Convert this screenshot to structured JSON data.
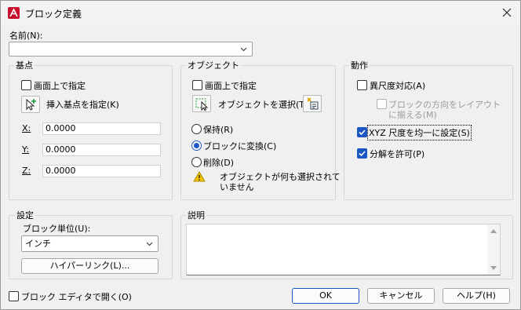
{
  "window": {
    "title": "ブロック定義"
  },
  "name_field": {
    "label": "名前(N):",
    "value": ""
  },
  "basepoint": {
    "title": "基点",
    "specify_on_screen": "画面上で指定",
    "pick_button": "挿入基点を指定(K)",
    "x_label": "X:",
    "x": "0.0000",
    "y_label": "Y:",
    "y": "0.0000",
    "z_label": "Z:",
    "z": "0.0000"
  },
  "objects": {
    "title": "オブジェクト",
    "specify_on_screen": "画面上で指定",
    "select_button": "オブジェクトを選択(T)",
    "retain": "保持(R)",
    "convert": "ブロックに変換(C)",
    "delete": "削除(D)",
    "warning": [
      "オブジェクトが何も選択されて",
      "いません"
    ]
  },
  "behavior": {
    "title": "動作",
    "annotative": "異尺度対応(A)",
    "match_orientation": [
      "ブロックの方向をレイアウト",
      "に揃える(M)"
    ],
    "uniform_scale": "XYZ 尺度を均一に設定(S)",
    "allow_explode": "分解を許可(P)"
  },
  "settings": {
    "title": "設定",
    "unit_label": "ブロック単位(U):",
    "unit_value": "インチ",
    "hyperlink": "ハイパーリンク(L)..."
  },
  "description": {
    "title": "説明",
    "value": ""
  },
  "footer": {
    "open_in_editor": "ブロック エディタで開く(O)",
    "ok": "OK",
    "cancel": "キャンセル",
    "help": "ヘルプ(H)"
  }
}
